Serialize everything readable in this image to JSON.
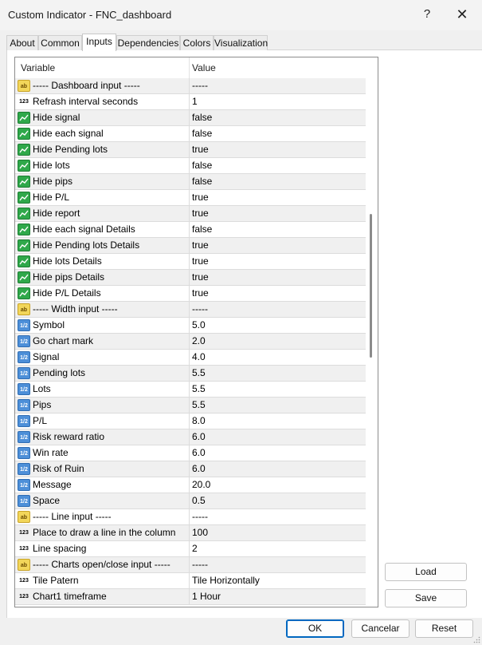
{
  "window": {
    "title": "Custom Indicator - FNC_dashboard",
    "help_glyph": "?",
    "close_glyph": "✕"
  },
  "tabs": [
    {
      "label": "About"
    },
    {
      "label": "Common"
    },
    {
      "label": "Inputs"
    },
    {
      "label": "Dependencies"
    },
    {
      "label": "Colors"
    },
    {
      "label": "Visualization"
    }
  ],
  "active_tab": "Inputs",
  "grid": {
    "headers": {
      "variable": "Variable",
      "value": "Value"
    },
    "rows": [
      {
        "type": "ab",
        "name": "----- Dashboard input -----",
        "value": "-----"
      },
      {
        "type": "int",
        "name": "Refrash interval seconds",
        "value": "1"
      },
      {
        "type": "bool",
        "name": "Hide signal",
        "value": "false"
      },
      {
        "type": "bool",
        "name": "Hide each signal",
        "value": "false"
      },
      {
        "type": "bool",
        "name": "Hide Pending lots",
        "value": "true"
      },
      {
        "type": "bool",
        "name": "Hide lots",
        "value": "false"
      },
      {
        "type": "bool",
        "name": "Hide pips",
        "value": "false"
      },
      {
        "type": "bool",
        "name": "Hide P/L",
        "value": "true"
      },
      {
        "type": "bool",
        "name": "Hide report",
        "value": "true"
      },
      {
        "type": "bool",
        "name": "Hide each signal Details",
        "value": "false"
      },
      {
        "type": "bool",
        "name": "Hide Pending lots Details",
        "value": "true"
      },
      {
        "type": "bool",
        "name": "Hide lots Details",
        "value": "true"
      },
      {
        "type": "bool",
        "name": "Hide pips Details",
        "value": "true"
      },
      {
        "type": "bool",
        "name": "Hide P/L Details",
        "value": "true"
      },
      {
        "type": "ab",
        "name": "----- Width input -----",
        "value": "-----"
      },
      {
        "type": "dbl",
        "name": "Symbol",
        "value": "5.0"
      },
      {
        "type": "dbl",
        "name": "Go chart mark",
        "value": "2.0"
      },
      {
        "type": "dbl",
        "name": "Signal",
        "value": "4.0"
      },
      {
        "type": "dbl",
        "name": "Pending lots",
        "value": "5.5"
      },
      {
        "type": "dbl",
        "name": "Lots",
        "value": "5.5"
      },
      {
        "type": "dbl",
        "name": "Pips",
        "value": "5.5"
      },
      {
        "type": "dbl",
        "name": "P/L",
        "value": "8.0"
      },
      {
        "type": "dbl",
        "name": "Risk reward ratio",
        "value": "6.0"
      },
      {
        "type": "dbl",
        "name": "Win rate",
        "value": "6.0"
      },
      {
        "type": "dbl",
        "name": "Risk of Ruin",
        "value": "6.0"
      },
      {
        "type": "dbl",
        "name": "Message",
        "value": "20.0"
      },
      {
        "type": "dbl",
        "name": "Space",
        "value": "0.5"
      },
      {
        "type": "ab",
        "name": "----- Line input -----",
        "value": "-----"
      },
      {
        "type": "int",
        "name": "Place to draw a line in the column",
        "value": "100"
      },
      {
        "type": "int",
        "name": "Line spacing",
        "value": "2"
      },
      {
        "type": "ab",
        "name": "----- Charts open/close input -----",
        "value": "-----"
      },
      {
        "type": "int",
        "name": "Tile Patern",
        "value": "Tile Horizontally"
      },
      {
        "type": "int",
        "name": "Chart1 timeframe",
        "value": "1 Hour"
      }
    ]
  },
  "icons": {
    "ab": "ab",
    "int": "123",
    "dbl": "1/2"
  },
  "buttons": {
    "load": "Load",
    "save": "Save",
    "ok": "OK",
    "cancel": "Cancelar",
    "reset": "Reset"
  },
  "colors": {
    "accent": "#0067c0",
    "bool_icon": "#2fa84a",
    "number_icon": "#4d8fd8",
    "string_icon": "#f2d65a"
  }
}
